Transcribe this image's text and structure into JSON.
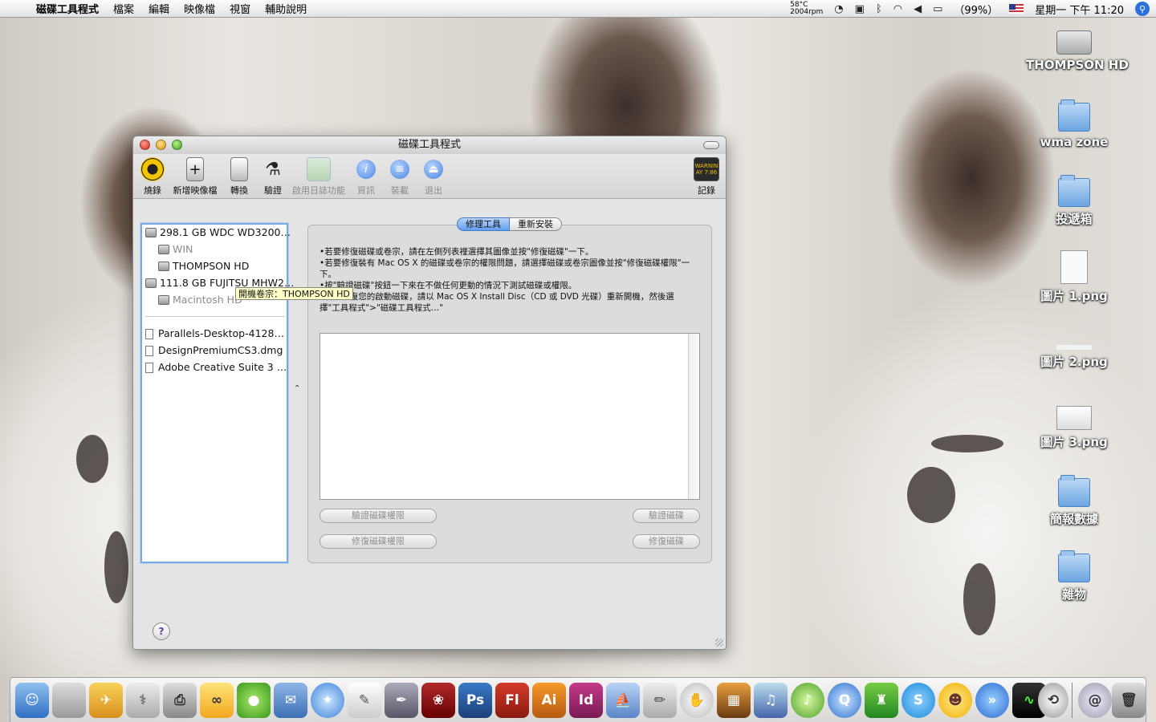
{
  "menubar": {
    "app_name": "磁碟工具程式",
    "menus": [
      "檔案",
      "編輯",
      "映像檔",
      "視窗",
      "輔助說明"
    ],
    "temperature": "58°C",
    "fan_speed": "2004rpm",
    "battery": "（99%）",
    "clock": "星期一 下午 11:20"
  },
  "desktop_icons": [
    {
      "label": "THOMPSON HD",
      "icon": "hard-drive-icon"
    },
    {
      "label": "wma zone",
      "icon": "folder-icon"
    },
    {
      "label": "投遞箱",
      "icon": "folder-icon"
    },
    {
      "label": "圖片 1.png",
      "icon": "png-file-icon"
    },
    {
      "label": "圖片 2.png",
      "icon": "png-file-icon"
    },
    {
      "label": "圖片 3.png",
      "icon": "png-file-icon"
    },
    {
      "label": "簡報數據",
      "icon": "folder-icon"
    },
    {
      "label": "雜物",
      "icon": "folder-icon"
    }
  ],
  "window": {
    "title": "磁碟工具程式",
    "toolbar": {
      "burn": "燒錄",
      "new_image": "新增映像檔",
      "convert": "轉換",
      "verify": "驗證",
      "journaling": "啟用日誌功能",
      "info": "資訊",
      "mount": "裝載",
      "eject": "退出",
      "log": "記錄",
      "log_badge": "WARNIN AY 7:86"
    },
    "disks": [
      {
        "label": "298.1 GB WDC WD3200…",
        "level": 0,
        "dim": false
      },
      {
        "label": "WIN",
        "level": 1,
        "dim": true
      },
      {
        "label": "THOMPSON HD",
        "level": 1,
        "dim": false
      },
      {
        "label": "111.8 GB FUJITSU MHW2…",
        "level": 0,
        "dim": false
      },
      {
        "label": "Macintosh HD",
        "level": 1,
        "dim": true
      }
    ],
    "images": [
      "Parallels-Desktop-4128…",
      "DesignPremiumCS3.dmg",
      "Adobe Creative Suite 3 …"
    ],
    "tooltip": "開機卷宗：THOMPSON HD",
    "tabs": [
      "修理工具",
      "重新安裝"
    ],
    "instructions": [
      "•若要修復磁碟或卷宗，請在左側列表裡選擇其圖像並按\"修復磁碟\"一下。",
      "•若要修復裝有 Mac OS X 的磁碟或卷宗的權限問題，請選擇磁碟或卷宗圖像並按\"修復磁碟權限\"一下。",
      "•按\"驗證磁碟\"按鈕一下來在不做任何更動的情況下測試磁碟或權限。",
      "•若要修復您的啟動磁碟，請以 Mac OS X Install Disc（CD 或 DVD 光碟）重新開機，然後選擇\"工具程式\">\"磁碟工具程式…\""
    ],
    "buttons": {
      "verify_permissions": "驗證磁碟權限",
      "repair_permissions": "修復磁碟權限",
      "verify_disk": "驗證磁碟",
      "repair_disk": "修復磁碟"
    },
    "help": "?"
  },
  "dock": [
    "Finder",
    "系統偏好設定",
    "Automator",
    "磁碟工具程式",
    "印表機",
    "Yahoo Messenger",
    "Adium",
    "郵件",
    "Safari",
    "文字編輯",
    "Graphic",
    "Illustrator",
    "Photoshop",
    "Flash",
    "Illustrator",
    "InDesign",
    "Dreamweaver",
    "繪圖",
    "輔助",
    "iPhoto",
    "iTunes",
    "iTunes",
    "QuickTime",
    "遊戲",
    "Skype",
    "Emoticon",
    "前進",
    "活動監視器",
    "時光機",
    "網路",
    "垃圾桶"
  ]
}
